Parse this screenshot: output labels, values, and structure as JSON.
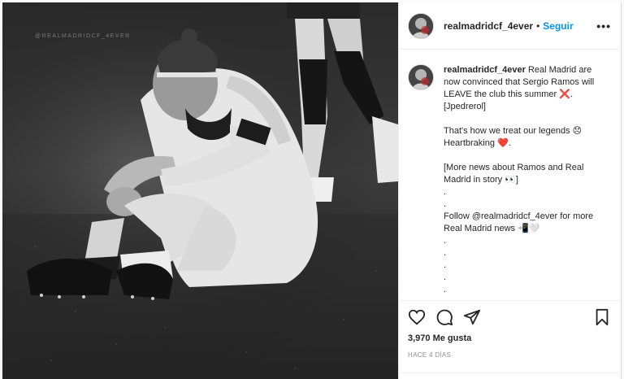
{
  "post": {
    "watermark": "@REALMADRIDCF_4EVER"
  },
  "header": {
    "username": "realmadridcf_4ever",
    "separator": "•",
    "follow_label": "Seguir",
    "more_label": "•••"
  },
  "caption": {
    "username": "realmadridcf_4ever",
    "lines": [
      "Real Madrid are now convinced that Sergio Ramos will LEAVE the club this summer ❌. [Jpedrerol]",
      "That's how we treat our legends 😞 Heartbraking ❤️.",
      "[More news about Ramos and Real Madrid in story 👀]",
      ".",
      ".",
      "Follow @realmadridcf_4ever for more Real Madrid news 📲🤍",
      ".",
      ".",
      ".",
      ".",
      "."
    ]
  },
  "actions": {
    "likes": "3,970 Me gusta",
    "time": "HACE 4 DÍAS"
  },
  "colors": {
    "accent": "#0095f6",
    "text": "#262626",
    "muted": "#8e8e8e",
    "border": "#dbdbdb"
  },
  "icons": [
    "heart-icon",
    "comment-icon",
    "share-icon",
    "bookmark-icon",
    "more-options-icon"
  ]
}
